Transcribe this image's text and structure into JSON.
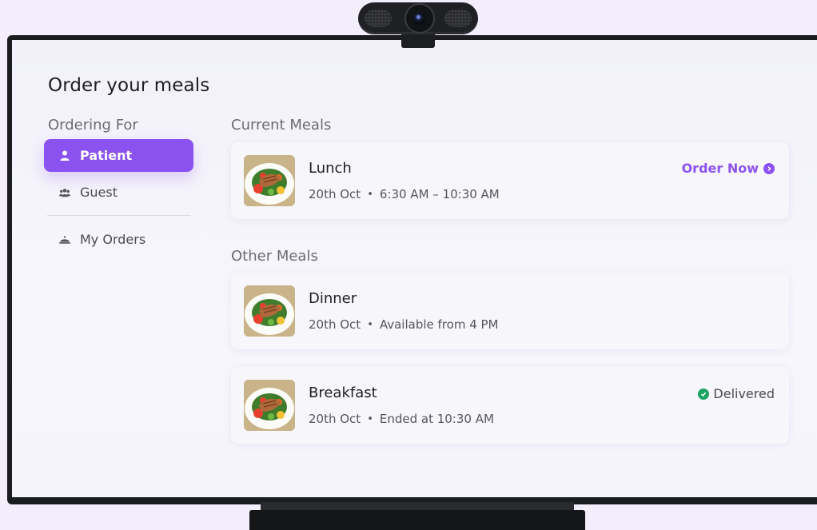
{
  "app": {
    "title": "Order your meals"
  },
  "sidebar": {
    "heading": "Ordering For",
    "items": [
      {
        "label": "Patient",
        "icon": "person-icon",
        "active": true
      },
      {
        "label": "Guest",
        "icon": "group-icon",
        "active": false
      },
      {
        "label": "My Orders",
        "icon": "cloche-icon",
        "active": false
      }
    ]
  },
  "current_meals": {
    "heading": "Current Meals",
    "items": [
      {
        "name": "Lunch",
        "date": "20th Oct",
        "detail": "6:30 AM – 10:30 AM",
        "action": "Order Now"
      }
    ]
  },
  "other_meals": {
    "heading": "Other Meals",
    "items": [
      {
        "name": "Dinner",
        "date": "20th Oct",
        "detail": "Available from 4 PM"
      },
      {
        "name": "Breakfast",
        "date": "20th Oct",
        "detail": "Ended at 10:30 AM",
        "status": "Delivered"
      }
    ]
  },
  "colors": {
    "accent": "#8b52f0",
    "success": "#1fa463"
  }
}
